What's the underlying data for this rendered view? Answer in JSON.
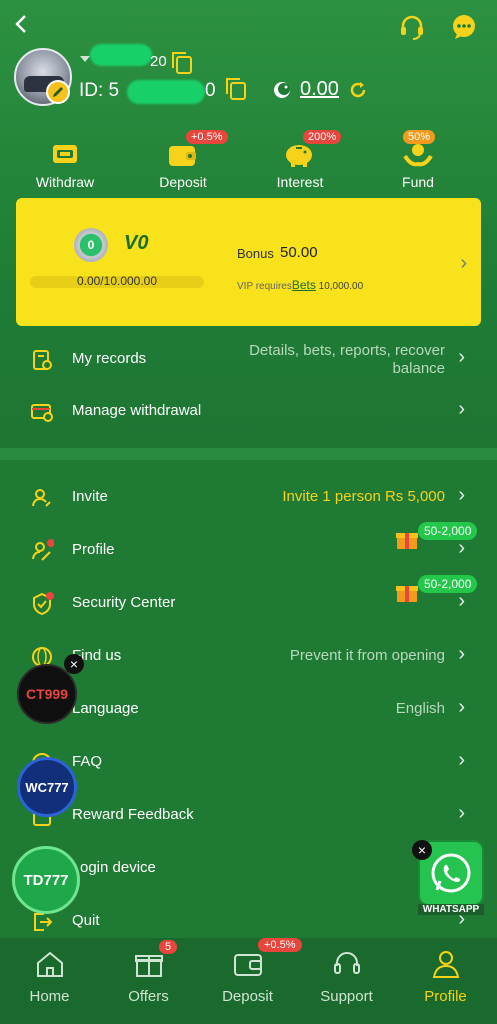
{
  "header": {
    "username_suffix": "20",
    "id_label": "ID: 5",
    "id_suffix": "0",
    "balance": "0.00"
  },
  "quick_actions": [
    {
      "label": "Withdraw",
      "icon": "withdraw-icon",
      "badge": ""
    },
    {
      "label": "Deposit",
      "icon": "wallet-icon",
      "badge": "+0.5%"
    },
    {
      "label": "Interest",
      "icon": "piggy-bank-icon",
      "badge": "200%"
    },
    {
      "label": "Fund",
      "icon": "fund-icon",
      "badge": "50%"
    }
  ],
  "vip": {
    "level": "V0",
    "medal_number": "0",
    "progress_text": "0.00/10.000.00",
    "progress": 0,
    "bonus_label": "Bonus",
    "bonus_value": "50.00",
    "requires_text": "VIP requires",
    "bets_link": "Bets",
    "requires_amount": "10,000.00"
  },
  "menu_top": [
    {
      "label": "My records",
      "value": "Details, bets, reports, recover balance"
    },
    {
      "label": "Manage withdrawal",
      "value": ""
    }
  ],
  "menu_main": [
    {
      "label": "Invite",
      "value": "Invite 1 person Rs 5,000"
    },
    {
      "label": "Profile",
      "value": "",
      "badge": "50-2,000"
    },
    {
      "label": "Security Center",
      "value": "",
      "badge": "50-2,000"
    },
    {
      "label": "Find us",
      "value": "Prevent it from opening"
    },
    {
      "label": "Language",
      "value": "English"
    },
    {
      "label": "FAQ",
      "value": ""
    },
    {
      "label": "Reward Feedback",
      "value": ""
    },
    {
      "label": "ogin device",
      "value": ""
    },
    {
      "label": "Quit",
      "value": ""
    }
  ],
  "floats": {
    "ct": "CT999",
    "wc": "WC777",
    "td": "TD777",
    "whatsapp": "WHATSAPP"
  },
  "tabs": [
    {
      "label": "Home",
      "badge": ""
    },
    {
      "label": "Offers",
      "badge": "5"
    },
    {
      "label": "Deposit",
      "badge": "+0.5%"
    },
    {
      "label": "Support",
      "badge": ""
    },
    {
      "label": "Profile",
      "badge": ""
    }
  ],
  "colors": {
    "accent": "#f6d31a",
    "background": "#1f7a34",
    "vip_card": "#f7e21b",
    "badge_red": "#e8453c"
  }
}
